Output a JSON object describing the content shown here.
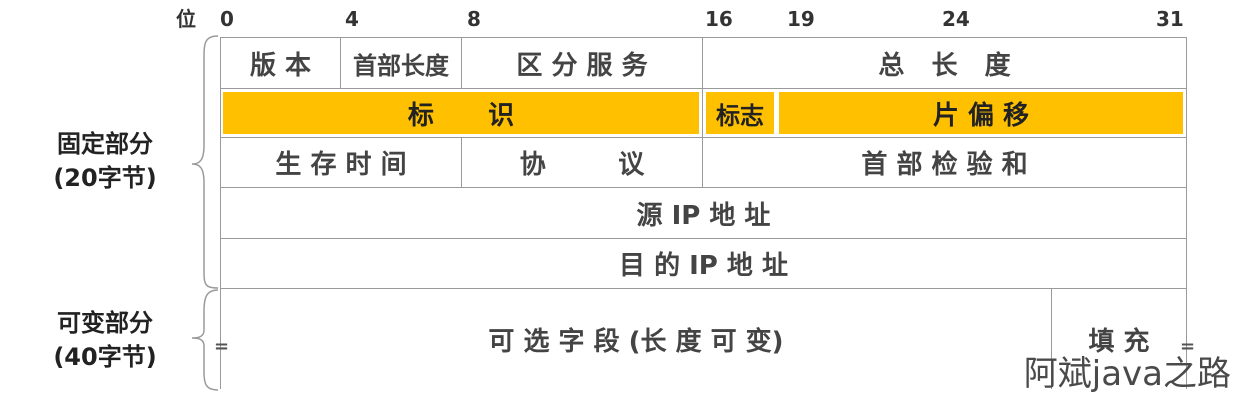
{
  "bit_axis": {
    "label": "位",
    "ticks": [
      "0",
      "4",
      "8",
      "16",
      "19",
      "24",
      "31"
    ]
  },
  "side_labels": {
    "fixed": {
      "line1": "固定部分",
      "line2": "(20字节)"
    },
    "variable": {
      "line1": "可变部分",
      "line2": "(40字节)"
    }
  },
  "fields": {
    "version": "版 本",
    "header_length": "首部长度",
    "service": "区 分 服 务",
    "total_length": "总   长   度",
    "identification": "标      识",
    "flags": "标志",
    "fragment_offset": "片 偏 移",
    "ttl": "生 存 时 间",
    "protocol": "协        议",
    "checksum": "首 部 检 验 和",
    "source_ip": "源 IP 地 址",
    "dest_ip": "目 的 IP 地 址",
    "options": "可 选 字 段 (长 度 可 变)",
    "padding": "填 充",
    "eq_left": "=",
    "eq_right": "="
  },
  "colors": {
    "highlight": "#FFC000",
    "border": "#9a9a9a"
  },
  "watermark": "阿斌java之路"
}
